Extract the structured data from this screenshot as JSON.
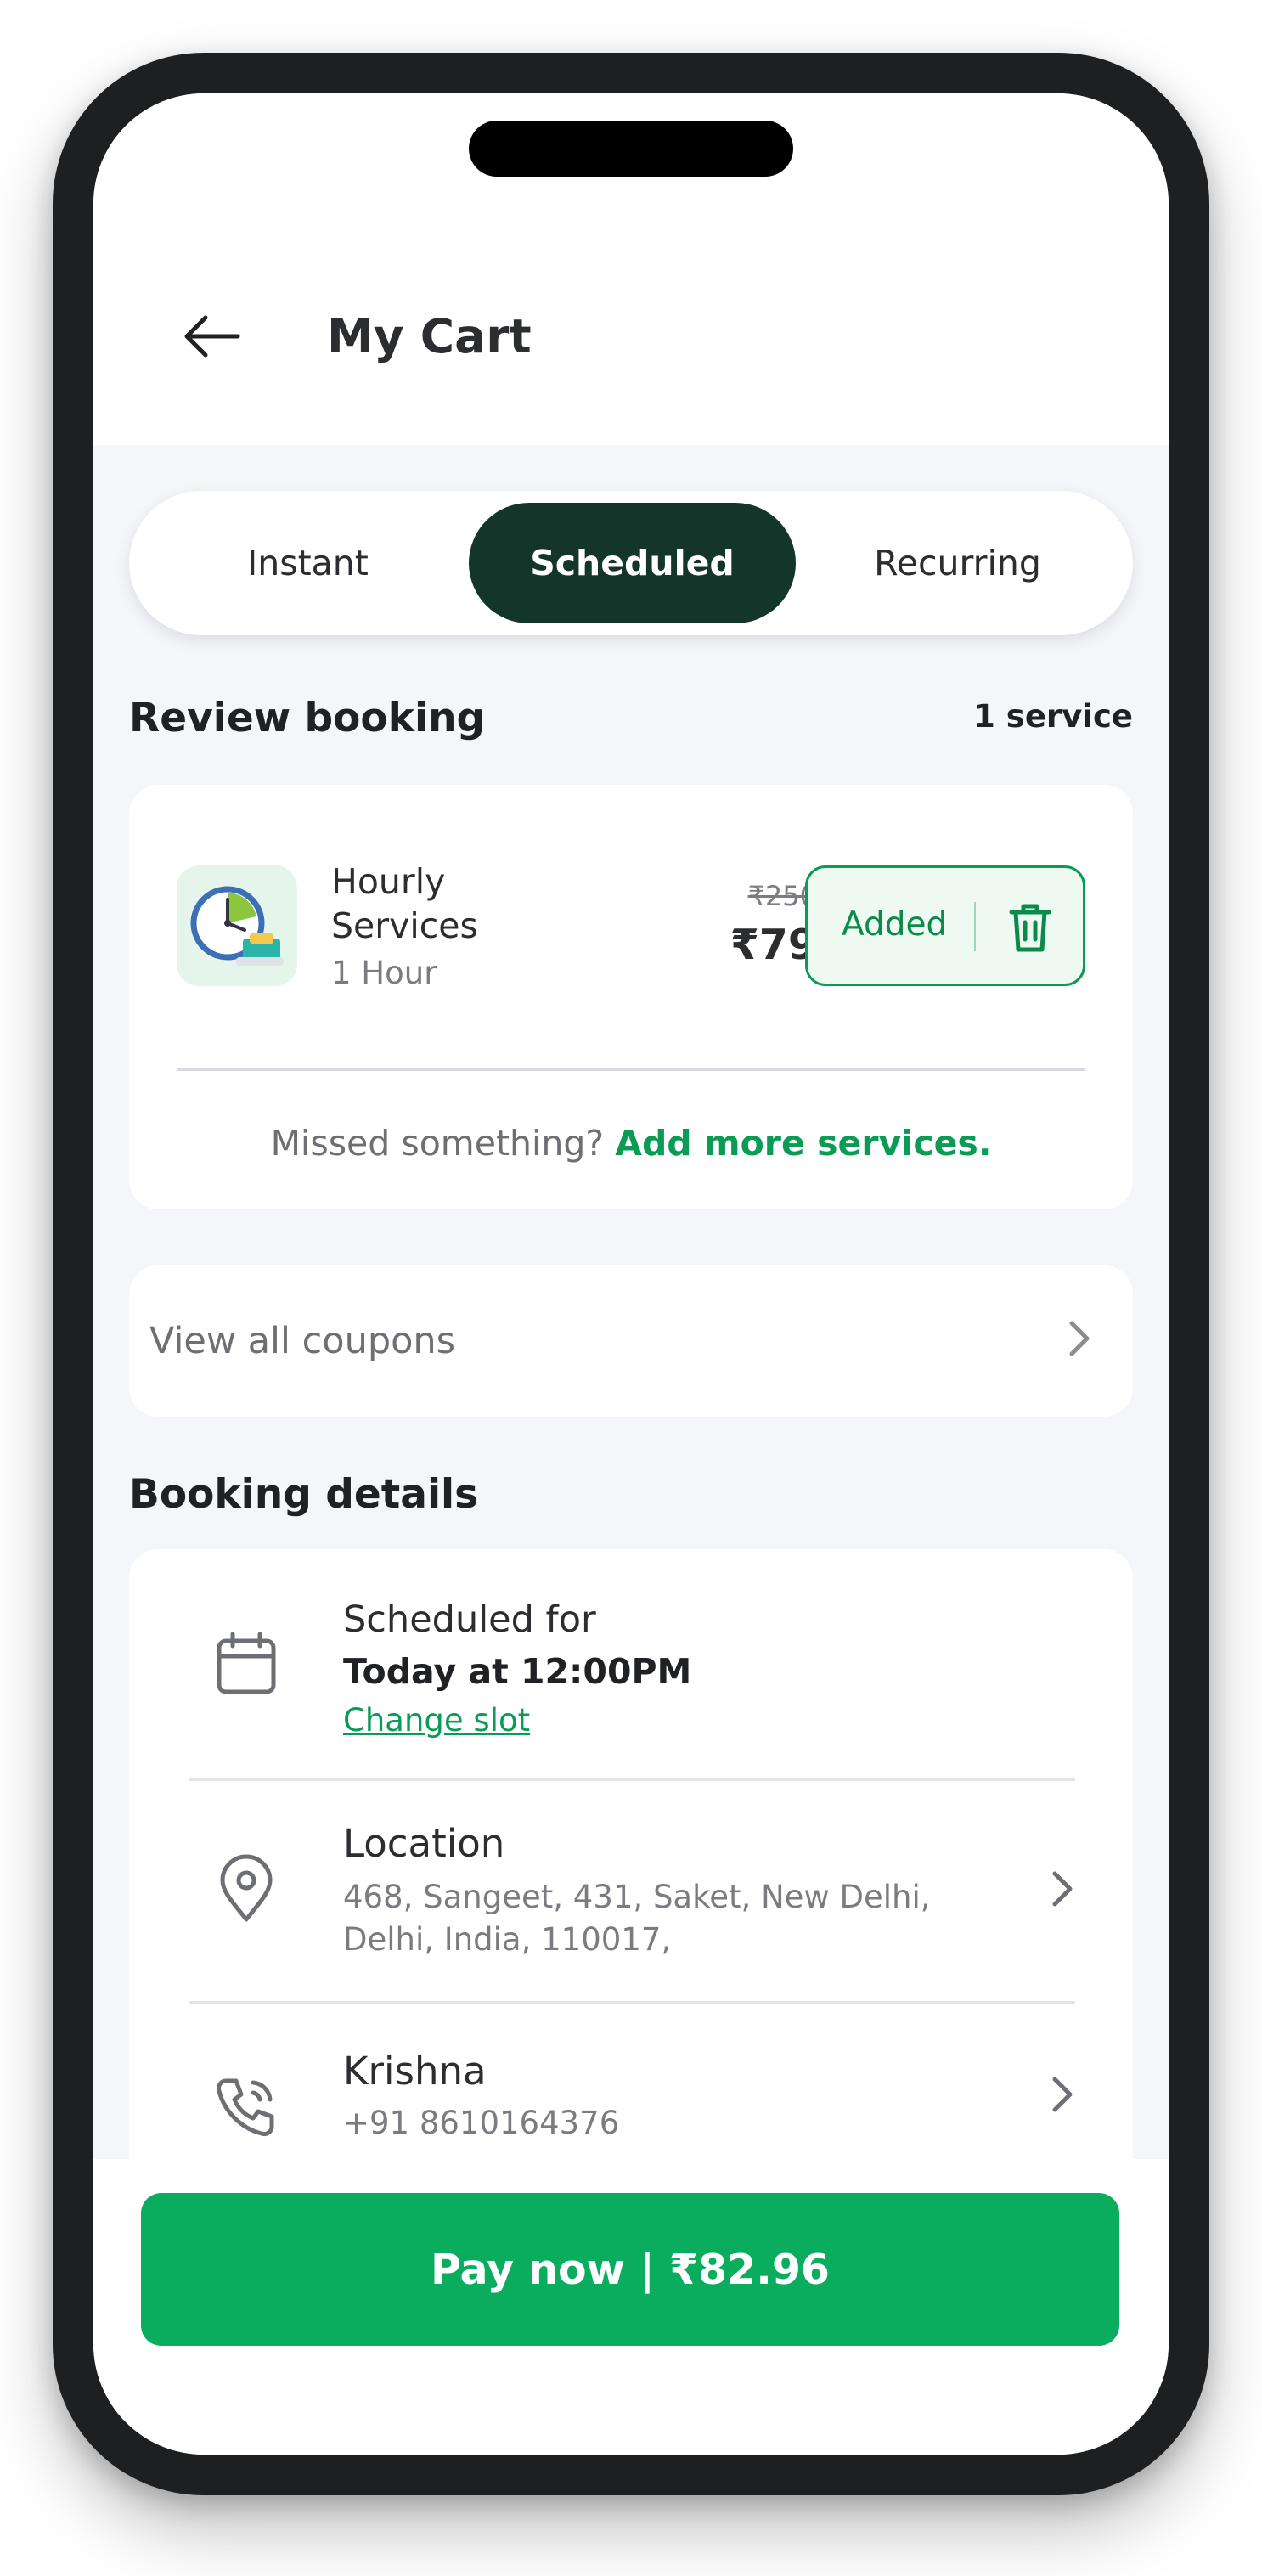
{
  "header": {
    "title": "My Cart"
  },
  "tabs": [
    {
      "label": "Instant",
      "active": false
    },
    {
      "label": "Scheduled",
      "active": true
    },
    {
      "label": "Recurring",
      "active": false
    }
  ],
  "review": {
    "title": "Review booking",
    "count": "1 service",
    "service": {
      "name": "Hourly Services",
      "duration": "1 Hour",
      "old_price": "₹250",
      "price": "₹79",
      "added_label": "Added"
    },
    "missed_text": "Missed something?",
    "add_more_link": "Add more services."
  },
  "coupons": {
    "label": "View all coupons"
  },
  "booking": {
    "title": "Booking details",
    "schedule": {
      "label": "Scheduled for",
      "time": "Today at 12:00PM",
      "change_link": "Change slot"
    },
    "location": {
      "title": "Location",
      "address": "468, Sangeet, 431, Saket, New Delhi, Delhi, India, 110017,"
    },
    "contact": {
      "name": "Krishna",
      "phone": "+91 8610164376"
    }
  },
  "pay_button": {
    "label": "Pay now | ₹82.96"
  },
  "colors": {
    "brand_green": "#0aad5e",
    "active_tab": "#14352a",
    "link_green": "#0a9c55"
  }
}
